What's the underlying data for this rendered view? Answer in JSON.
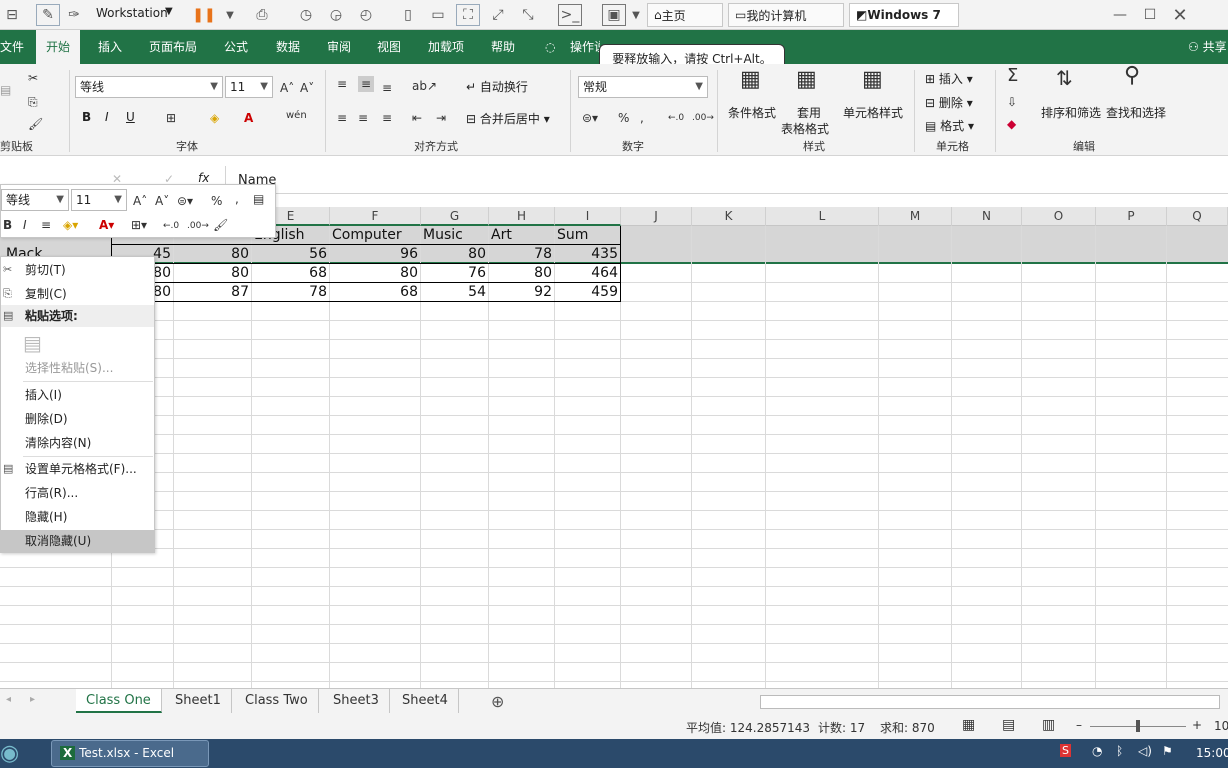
{
  "vmbar": {
    "workstation": "Workstation",
    "tabs": [
      "主页",
      "我的计算机",
      "Windows 7"
    ]
  },
  "ribbon": {
    "tabs": [
      "文件",
      "开始",
      "插入",
      "页面布局",
      "公式",
      "数据",
      "审阅",
      "视图",
      "加载项",
      "帮助",
      "操作说明搜索"
    ],
    "share": "共享",
    "font_name": "等线",
    "font_size": "11",
    "number_format": "常规",
    "wrap": "自动换行",
    "merge": "合并后居中",
    "bold": "B",
    "italic": "I",
    "underline": "U",
    "cond": "条件格式",
    "table1": "套用",
    "table2": "表格格式",
    "cellstyle": "单元格样式",
    "insert": "插入",
    "delete": "删除",
    "format": "格式",
    "sort": "排序和筛选",
    "find": "查找和选择",
    "groups": [
      "剪贴板",
      "字体",
      "对齐方式",
      "数字",
      "样式",
      "单元格",
      "编辑"
    ]
  },
  "tooltip": "要释放输入，请按 Ctrl+Alt。",
  "formula": {
    "content": "Name"
  },
  "columns": [
    "E",
    "F",
    "G",
    "H",
    "I",
    "J",
    "K",
    "L",
    "M",
    "N",
    "O",
    "P",
    "Q"
  ],
  "table": {
    "headers": [
      "English",
      "Computer",
      "Music",
      "Art",
      "Sum"
    ],
    "row_label": "Mack",
    "rows": [
      {
        "c": "45",
        "d": "80",
        "e": "56",
        "f": "96",
        "g": "80",
        "h": "78",
        "i": "435"
      },
      {
        "c": "80",
        "d": "80",
        "e": "68",
        "f": "80",
        "g": "76",
        "h": "80",
        "i": "464"
      },
      {
        "c": "80",
        "d": "87",
        "e": "78",
        "f": "68",
        "g": "54",
        "h": "92",
        "i": "459"
      }
    ]
  },
  "mini": {
    "font": "等线",
    "size": "11",
    "pct": "%",
    "comma": ","
  },
  "context_menu": {
    "cut": "剪切(T)",
    "copy": "复制(C)",
    "paste_header": "粘贴选项:",
    "paste_special": "选择性粘贴(S)...",
    "insert": "插入(I)",
    "delete": "删除(D)",
    "clear": "清除内容(N)",
    "format_cells": "设置单元格格式(F)...",
    "row_height": "行高(R)...",
    "hide": "隐藏(H)",
    "unhide": "取消隐藏(U)"
  },
  "sheets": [
    "Class One",
    "Sheet1",
    "Class Two",
    "Sheet3",
    "Sheet4"
  ],
  "status": {
    "avg": "平均值: 124.2857143",
    "count": "计数: 17",
    "sum": "求和: 870",
    "zoom": "10"
  },
  "taskbar": {
    "app": "Test.xlsx - Excel",
    "time": "15:00"
  }
}
